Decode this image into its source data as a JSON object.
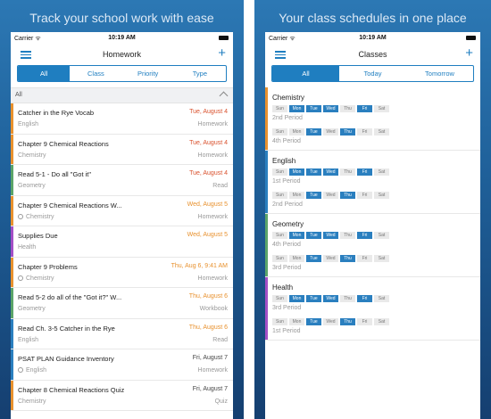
{
  "left_panel": {
    "tagline": "Track your school work with ease",
    "status": {
      "carrier": "Carrier ᯤ",
      "time": "10:19 AM"
    },
    "nav_title": "Homework",
    "tabs": [
      "All",
      "Class",
      "Priority",
      "Type"
    ],
    "section_label": "All",
    "rows": [
      {
        "title": "Catcher in the Rye Vocab",
        "date": "Tue, August 4",
        "subject": "English",
        "category": "Homework",
        "color": "#e8912e",
        "date_color": "#d9502c",
        "clock": false
      },
      {
        "title": "Chapter 9 Chemical Reactions",
        "date": "Tue, August 4",
        "subject": "Chemistry",
        "category": "Homework",
        "color": "#e8912e",
        "date_color": "#d9502c",
        "clock": false
      },
      {
        "title": "Read 5-1 - Do all \"Got it\"",
        "date": "Tue, August 4",
        "subject": "Geometry",
        "category": "Read",
        "color": "#5aa469",
        "date_color": "#d9502c",
        "clock": false
      },
      {
        "title": "Chapter 9 Chemical Reactions W...",
        "date": "Wed, August 5",
        "subject": "Chemistry",
        "category": "Homework",
        "color": "#e8912e",
        "date_color": "#e8912e",
        "clock": true
      },
      {
        "title": "Supplies Due",
        "date": "Wed, August 5",
        "subject": "Health",
        "category": "",
        "color": "#a34fc6",
        "date_color": "#e8912e",
        "clock": false
      },
      {
        "title": "Chapter 9 Problems",
        "date": "Thu, Aug 6, 9:41 AM",
        "subject": "Chemistry",
        "category": "Homework",
        "color": "#e8912e",
        "date_color": "#e8912e",
        "clock": true
      },
      {
        "title": "Read 5-2 do all of the \"Got it?\" W...",
        "date": "Thu, August 6",
        "subject": "Geometry",
        "category": "Workbook",
        "color": "#5aa469",
        "date_color": "#e8912e",
        "clock": false
      },
      {
        "title": "Read Ch. 3-5 Catcher in the Rye",
        "date": "Thu, August 6",
        "subject": "English",
        "category": "Read",
        "color": "#2a7fbf",
        "date_color": "#e8912e",
        "clock": false
      },
      {
        "title": "PSAT PLAN Guidance Inventory",
        "date": "Fri, August 7",
        "subject": "English",
        "category": "Homework",
        "color": "#2a7fbf",
        "date_color": "#444444",
        "clock": true
      },
      {
        "title": "Chapter 8 Chemical Reactions Quiz",
        "date": "Fri, August 7",
        "subject": "Chemistry",
        "category": "Quiz",
        "color": "#e8912e",
        "date_color": "#444444",
        "clock": false
      }
    ]
  },
  "right_panel": {
    "tagline": "Your class schedules in one place",
    "status": {
      "carrier": "Carrier ᯤ",
      "time": "10:19 AM"
    },
    "nav_title": "Classes",
    "tabs": [
      "All",
      "Today",
      "Tomorrow"
    ],
    "day_names": [
      "Sun",
      "Mon",
      "Tue",
      "Wed",
      "Thu",
      "Fri",
      "Sat"
    ],
    "classes": [
      {
        "name": "Chemistry",
        "color": "#e8912e",
        "periods": [
          {
            "label": "2nd Period",
            "days": [
              false,
              true,
              true,
              true,
              false,
              true,
              false
            ]
          },
          {
            "label": "4th Period",
            "days": [
              false,
              false,
              true,
              false,
              true,
              false,
              false
            ]
          }
        ]
      },
      {
        "name": "English",
        "color": "#2a7fbf",
        "periods": [
          {
            "label": "1st Period",
            "days": [
              false,
              true,
              true,
              true,
              false,
              true,
              false
            ]
          },
          {
            "label": "2nd Period",
            "days": [
              false,
              false,
              true,
              false,
              true,
              false,
              false
            ]
          }
        ]
      },
      {
        "name": "Geometry",
        "color": "#5aa469",
        "periods": [
          {
            "label": "4th Period",
            "days": [
              false,
              true,
              true,
              true,
              false,
              true,
              false
            ]
          },
          {
            "label": "3rd Period",
            "days": [
              false,
              false,
              true,
              false,
              true,
              false,
              false
            ]
          }
        ]
      },
      {
        "name": "Health",
        "color": "#a34fc6",
        "periods": [
          {
            "label": "3rd Period",
            "days": [
              false,
              true,
              true,
              true,
              false,
              true,
              false
            ]
          },
          {
            "label": "1st Period",
            "days": [
              false,
              false,
              true,
              false,
              true,
              false,
              false
            ]
          }
        ]
      }
    ]
  }
}
